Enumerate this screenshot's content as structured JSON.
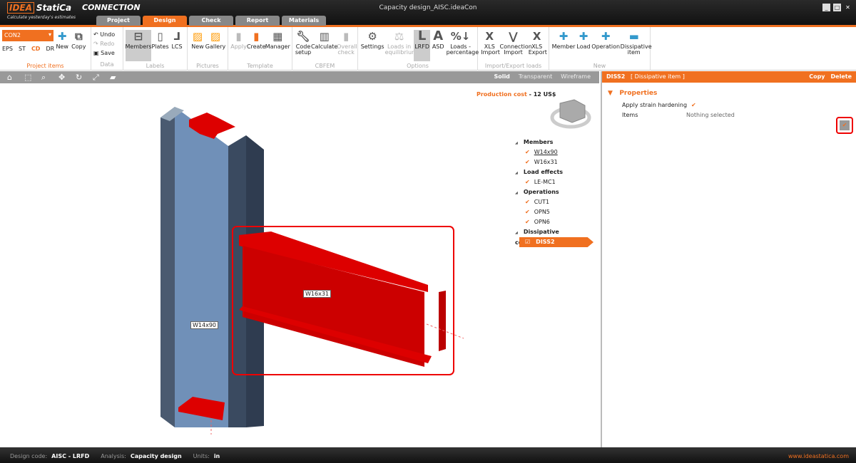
{
  "app": {
    "logo": "IDEA StatiCa",
    "product": "CONNECTION",
    "tagline": "Calculate yesterday's estimates",
    "title": "Capacity design_AISC.ideaCon"
  },
  "tabs": [
    "Project",
    "Design",
    "Check",
    "Report",
    "Materials"
  ],
  "ribbon": {
    "project_items": {
      "combo": "CON2",
      "modes": [
        "EPS",
        "ST",
        "CD",
        "DR"
      ],
      "new": "New",
      "copy": "Copy",
      "label": "Project items"
    },
    "data": {
      "undo": "Undo",
      "redo": "Redo",
      "save": "Save",
      "label": "Data"
    },
    "labels": {
      "members": "Members",
      "plates": "Plates",
      "lcs": "LCS",
      "label": "Labels"
    },
    "pictures": {
      "new": "New",
      "gallery": "Gallery",
      "label": "Pictures"
    },
    "template": {
      "apply": "Apply",
      "create": "Create",
      "manager": "Manager",
      "label": "Template"
    },
    "cbfem": {
      "code": "Code setup",
      "calculate": "Calculate",
      "overall": "Overall check",
      "label": "CBFEM"
    },
    "options": {
      "settings": "Settings",
      "loads_eq": "Loads in equilibrium",
      "lrfd": "LRFD",
      "asd": "ASD",
      "loads_pct": "Loads - percentage",
      "label": "Options"
    },
    "import_export": {
      "xls_import": "XLS Import",
      "conn_import": "Connection Import",
      "xls_export": "XLS Export",
      "label": "Import/Export loads"
    },
    "new": {
      "member": "Member",
      "load": "Load",
      "operation": "Operation",
      "dissipative": "Dissipative item",
      "label": "New"
    }
  },
  "view_modes": [
    "Solid",
    "Transparent",
    "Wireframe"
  ],
  "viewport": {
    "cost_label": "Production cost",
    "cost_value": "12 US$",
    "column_label": "W14x90",
    "beam_label": "W16x31"
  },
  "tree": [
    {
      "header": "Members",
      "items": [
        "W14x90",
        "W16x31"
      ]
    },
    {
      "header": "Load effects",
      "items": [
        "LE-MC1"
      ]
    },
    {
      "header": "Operations",
      "items": [
        "CUT1",
        "OPN5",
        "OPN6"
      ]
    },
    {
      "header": "Dissipative components",
      "items": [
        "DISS2"
      ]
    }
  ],
  "panel": {
    "name": "DISS2",
    "type": "[ Dissipative item ]",
    "copy": "Copy",
    "delete": "Delete",
    "section": "Properties",
    "strain_label": "Apply strain hardening",
    "items_label": "Items",
    "items_value": "Nothing selected"
  },
  "status": {
    "code_label": "Design code:",
    "code": "AISC - LRFD",
    "analysis_label": "Analysis:",
    "analysis": "Capacity design",
    "units_label": "Units:",
    "units": "in",
    "url": "www.ideastatica.com"
  },
  "colors": {
    "accent": "#f07020",
    "steel": "#7090b8",
    "highlight": "#cc0000"
  }
}
